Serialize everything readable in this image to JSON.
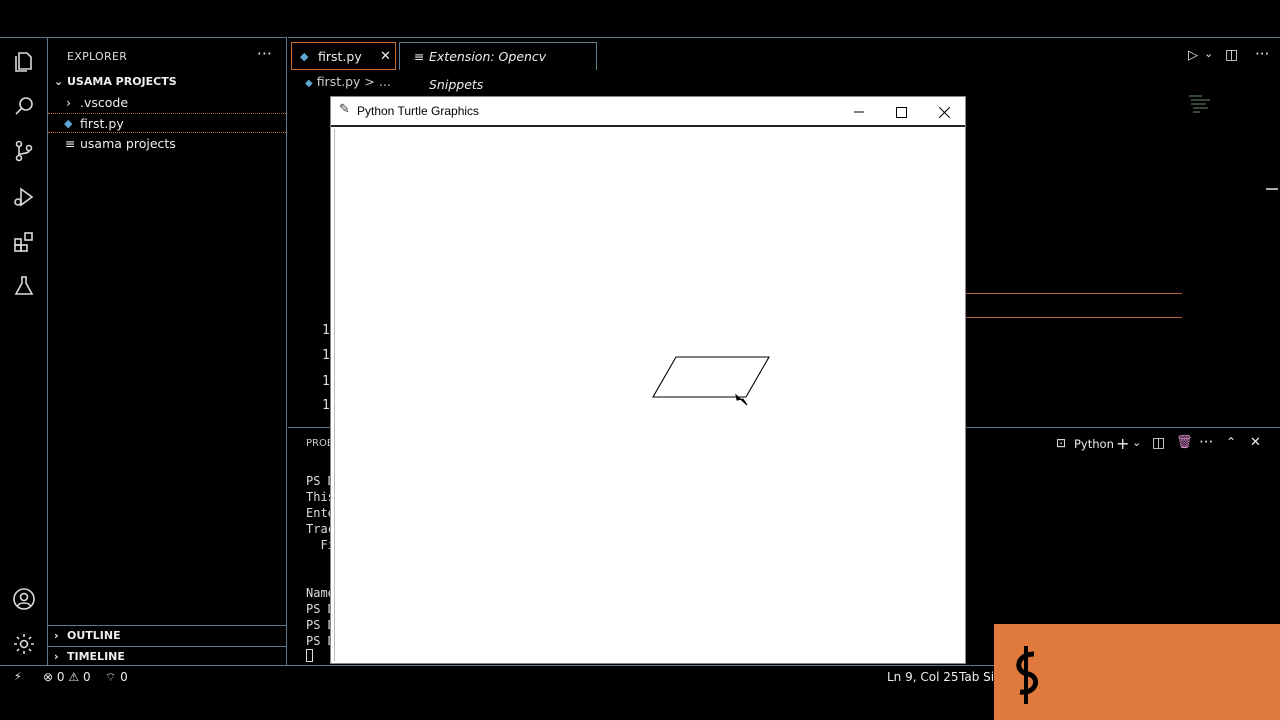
{
  "sidebar": {
    "title": "EXPLORER",
    "more_icon": "ellipsis-icon",
    "project": "USAMA PROJECTS",
    "items": [
      {
        "label": ".vscode",
        "icon": "chevron-right-icon"
      },
      {
        "label": "first.py",
        "icon": "python-file-icon"
      },
      {
        "label": "usama projects",
        "icon": "text-file-icon"
      }
    ],
    "outline": "OUTLINE",
    "timeline": "TIMELINE"
  },
  "tabs": [
    {
      "label": "first.py",
      "icon": "python-file-icon",
      "active": true
    },
    {
      "label": "Extension: Opencv Snippets",
      "icon": "extension-preview-icon",
      "active": false
    }
  ],
  "breadcrumb": {
    "file": "first.py",
    "sep": ">",
    "rest": "..."
  },
  "editor": {
    "line_numbers": [
      "1",
      "1",
      "1",
      "1"
    ]
  },
  "panel": {
    "tab_label": "PROB",
    "terminal_label": "Python",
    "terminal_lines": [
      "PS D",
      "This",
      "Ente",
      "Trac",
      "  Fi",
      "",
      "Name",
      "PS D",
      "PS D",
      "PS D"
    ]
  },
  "turtle_window": {
    "title": "Python Turtle Graphics"
  },
  "statusbar": {
    "errors": "0",
    "warnings": "0",
    "ports": "0",
    "position": "Ln 9, Col 25",
    "tab_size": "Tab Siz"
  },
  "colors": {
    "accent": "#c96b2b",
    "border": "#5e7a8a",
    "logo_bg": "#e07a3c"
  }
}
